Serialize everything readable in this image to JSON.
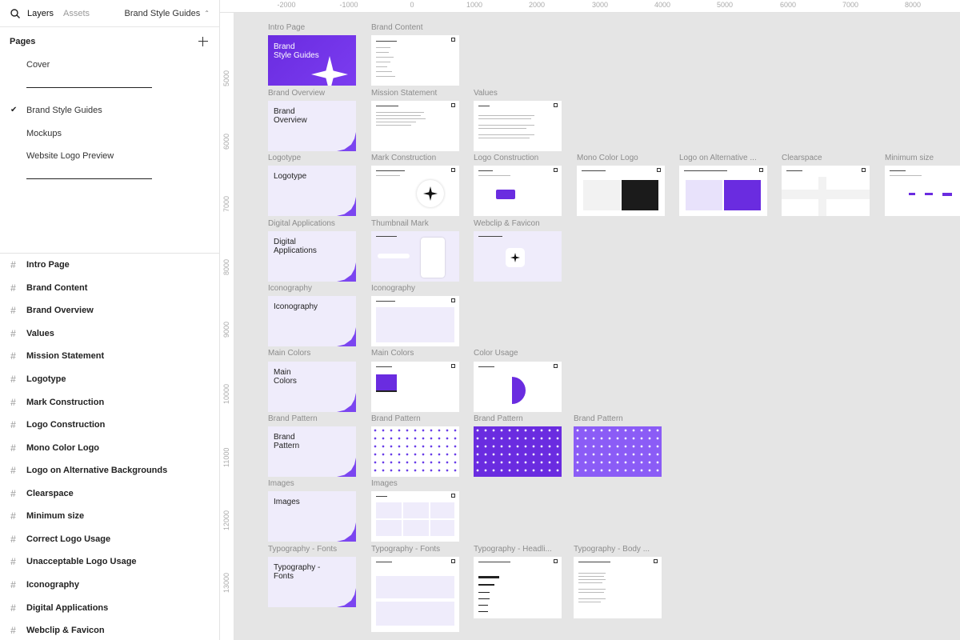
{
  "topbar": {
    "layers_tab": "Layers",
    "assets_tab": "Assets",
    "file_name": "Brand Style Guides"
  },
  "pages": {
    "title": "Pages",
    "items": [
      "Cover",
      "Brand Style Guides",
      "Mockups",
      "Website Logo Preview"
    ],
    "current": "Brand Style Guides"
  },
  "layers": [
    "Intro Page",
    "Brand Content",
    "Brand Overview",
    "Values",
    "Mission Statement",
    "Logotype",
    "Mark Construction",
    "Logo Construction",
    "Mono Color Logo",
    "Logo on Alternative Backgrounds",
    "Clearspace",
    "Minimum size",
    "Correct Logo Usage",
    "Unacceptable Logo Usage",
    "Iconography",
    "Digital Applications",
    "Webclip & Favicon"
  ],
  "ruler": {
    "top": [
      "-2000",
      "-1000",
      "0",
      "1000",
      "2000",
      "3000",
      "4000",
      "5000",
      "6000",
      "7000",
      "8000"
    ],
    "left": [
      "5000",
      "6000",
      "7000",
      "8000",
      "9000",
      "10000",
      "11000",
      "12000",
      "13000"
    ]
  },
  "frames": {
    "labels": {
      "intro": "Intro Page",
      "brand_content": "Brand Content",
      "brand_overview": "Brand Overview",
      "mission": "Mission Statement",
      "values": "Values",
      "logotype": "Logotype",
      "mark_construction": "Mark Construction",
      "logo_construction": "Logo Construction",
      "mono": "Mono Color Logo",
      "alt_bg": "Logo on Alternative ...",
      "clearspace": "Clearspace",
      "min_size": "Minimum size",
      "digital": "Digital Applications",
      "thumbnail": "Thumbnail Mark",
      "webclip": "Webclip & Favicon",
      "icon_a": "Iconography",
      "icon_b": "Iconography",
      "colors_a": "Main Colors",
      "colors_b": "Main Colors",
      "color_usage": "Color Usage",
      "pattern_a": "Brand Pattern",
      "pattern_b": "Brand Pattern",
      "pattern_c": "Brand Pattern",
      "pattern_d": "Brand Pattern",
      "images_a": "Images",
      "images_b": "Images",
      "typo_a": "Typography - Fonts",
      "typo_b": "Typography - Fonts",
      "typo_head": "Typography - Headli...",
      "typo_body": "Typography - Body ..."
    },
    "titles": {
      "intro": "Brand\nStyle Guides",
      "overview": "Brand\nOverview",
      "logotype": "Logotype",
      "digital": "Digital\nApplications",
      "iconography": "Iconography",
      "colors": "Main\nColors",
      "pattern": "Brand\nPattern",
      "images": "Images",
      "typography": "Typography -\nFonts"
    }
  },
  "colors": {
    "brand": "#6a2ce0",
    "section_bg": "#efecfb",
    "canvas": "#e5e5e5"
  }
}
